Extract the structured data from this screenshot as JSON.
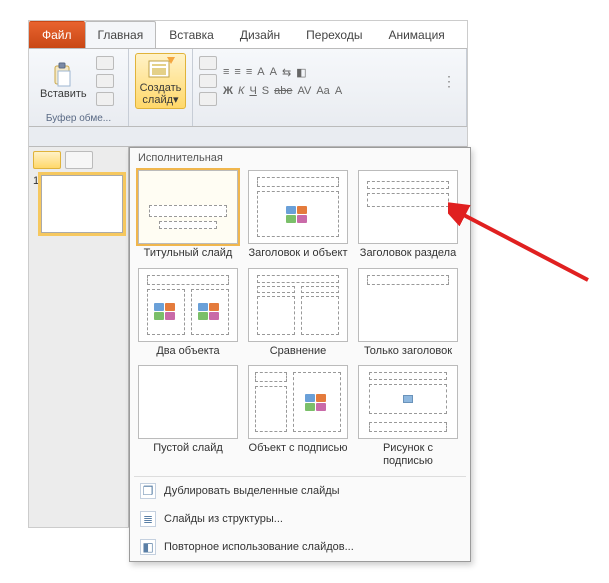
{
  "tabs": {
    "file": "Файл",
    "home": "Главная",
    "insert": "Вставка",
    "design": "Дизайн",
    "transitions": "Переходы",
    "animations": "Анимация"
  },
  "ribbon": {
    "paste": "Вставить",
    "clipboard_group": "Буфер обме...",
    "new_slide_line1": "Создать",
    "new_slide_line2": "слайд",
    "font_sym_row1": [
      "≡",
      "≡",
      "≡",
      "A",
      "A",
      "⇆",
      "◧"
    ],
    "font_sym_row2": [
      "Ж",
      "К",
      "Ч",
      "S",
      "abe",
      "AV",
      "Aa",
      "A"
    ]
  },
  "leftpane": {
    "slide_number": "1"
  },
  "gallery": {
    "section": "Исполнительная",
    "layouts": [
      {
        "label": "Титульный слайд"
      },
      {
        "label": "Заголовок и объект"
      },
      {
        "label": "Заголовок раздела"
      },
      {
        "label": "Два объекта"
      },
      {
        "label": "Сравнение"
      },
      {
        "label": "Только заголовок"
      },
      {
        "label": "Пустой слайд"
      },
      {
        "label": "Объект с подписью"
      },
      {
        "label": "Рисунок с подписью"
      }
    ],
    "cmd_duplicate": "Дублировать выделенные слайды",
    "cmd_outline": "Слайды из структуры...",
    "cmd_reuse": "Повторное использование слайдов..."
  }
}
